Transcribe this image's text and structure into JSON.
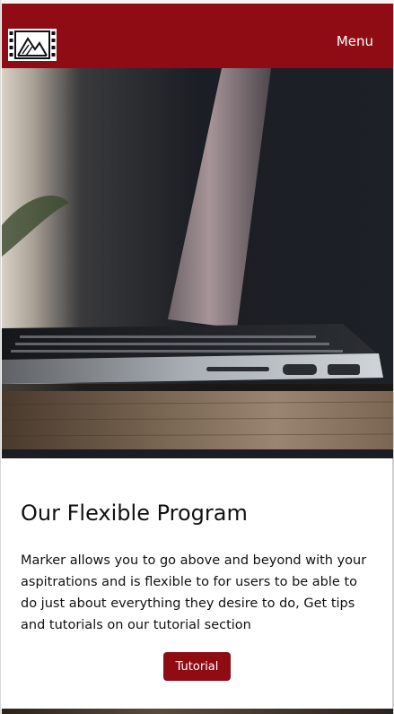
{
  "navbar": {
    "logo_icon": "film-mountain-logo-icon",
    "menu_label": "Menu"
  },
  "hero": {
    "image_description_icon": "laptop-photo"
  },
  "section": {
    "title": "Our Flexible Program",
    "body": "Marker allows you to go above and beyond with your aspitrations and is flexible to for users to be able to do just about everything they desire to do, Get tips and tutorials on our tutorial section",
    "button_label": "Tutorial"
  },
  "colors": {
    "brand": "#900c14",
    "text": "#111111",
    "background": "#ffffff"
  }
}
